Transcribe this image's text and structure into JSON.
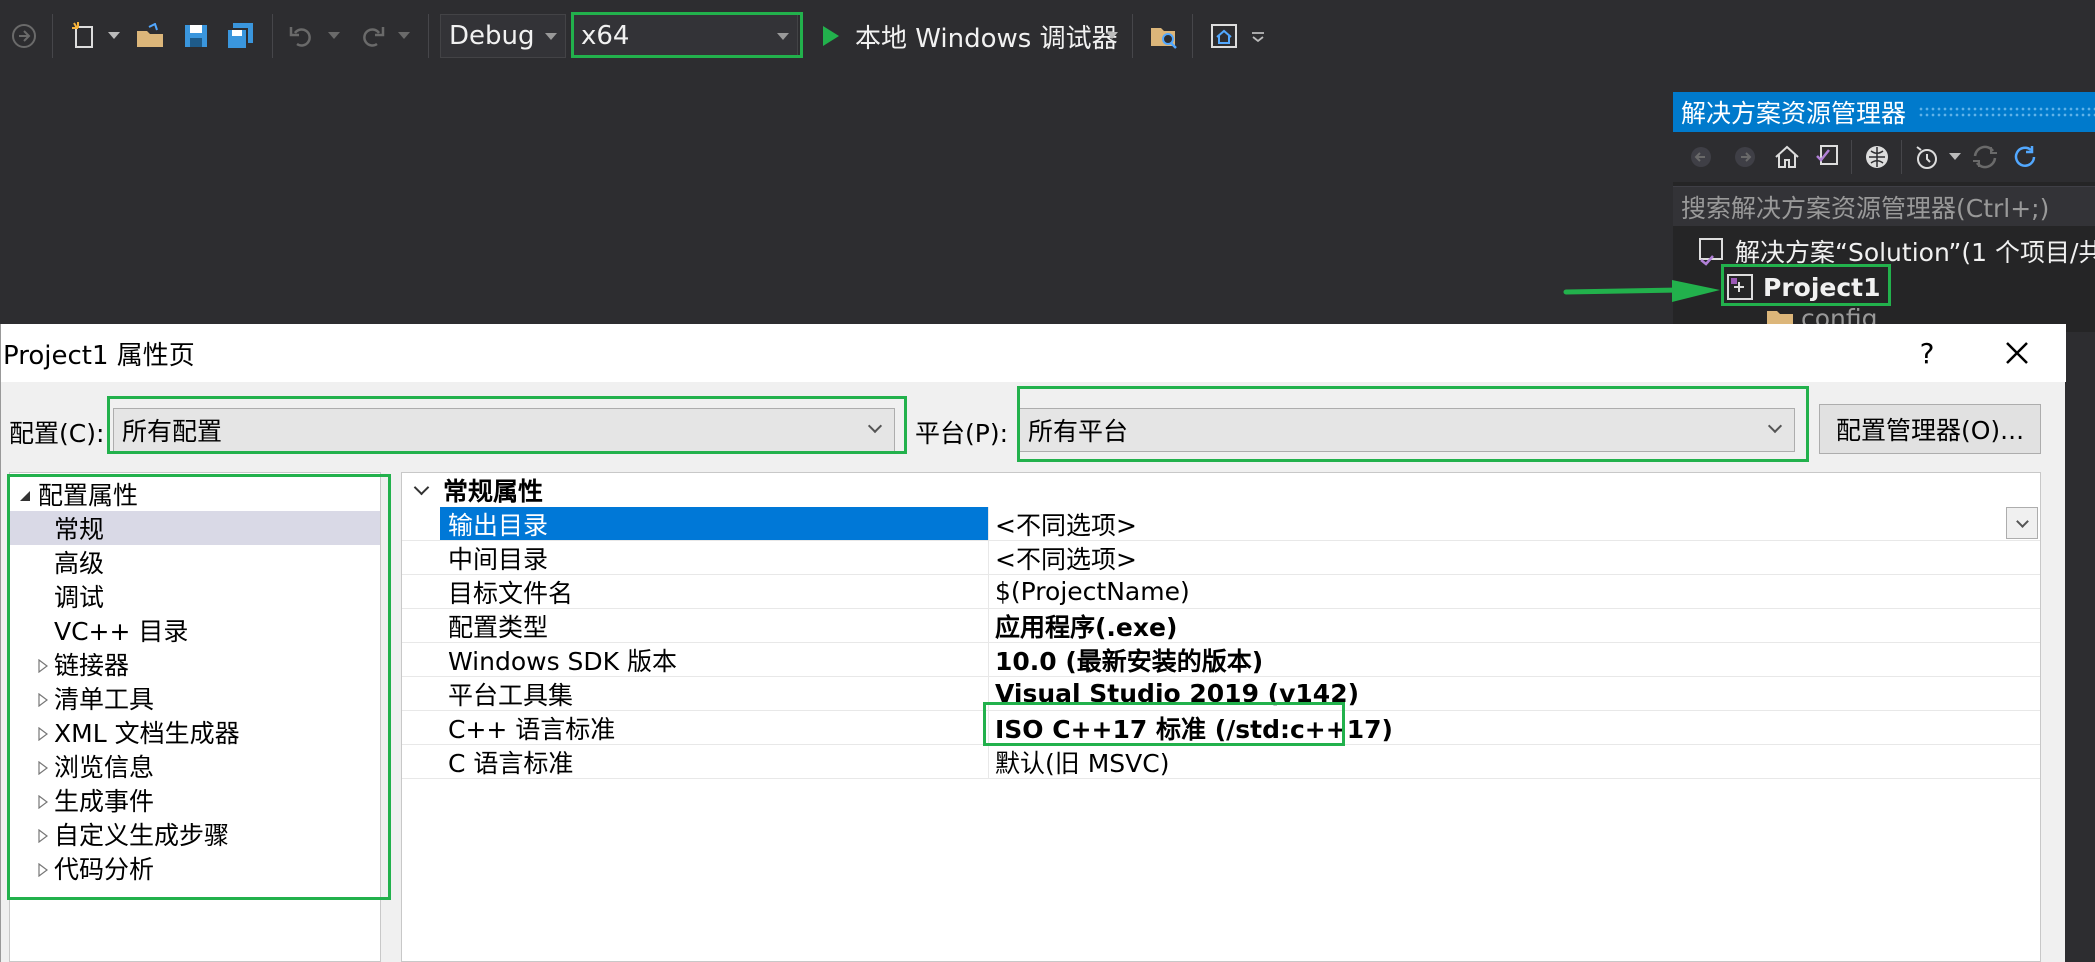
{
  "toolbar": {
    "configuration": "Debug",
    "platform": "x64",
    "run_label": "本地 Windows 调试器"
  },
  "solution_explorer": {
    "title": "解决方案资源管理器",
    "search_placeholder": "搜索解决方案资源管理器(Ctrl+;)",
    "solution_label": "解决方案“Solution”(1 个项目/共",
    "project_label": "Project1",
    "partial_folder": "config"
  },
  "dialog": {
    "title": "Project1 属性页",
    "help_label": "?",
    "close_label": "✕",
    "config_label": "配置(C):",
    "config_value": "所有配置",
    "platform_label": "平台(P):",
    "platform_value": "所有平台",
    "config_manager_label": "配置管理器(O)..."
  },
  "tree": {
    "root": "配置属性",
    "items": [
      {
        "label": "常规"
      },
      {
        "label": "高级"
      },
      {
        "label": "调试"
      },
      {
        "label": "VC++ 目录"
      },
      {
        "label": "链接器"
      },
      {
        "label": "清单工具"
      },
      {
        "label": "XML 文档生成器"
      },
      {
        "label": "浏览信息"
      },
      {
        "label": "生成事件"
      },
      {
        "label": "自定义生成步骤"
      },
      {
        "label": "代码分析"
      }
    ]
  },
  "grid": {
    "section": "常规属性",
    "rows": [
      {
        "name": "输出目录",
        "value": "<不同选项>"
      },
      {
        "name": "中间目录",
        "value": "<不同选项>"
      },
      {
        "name": "目标文件名",
        "value": "$(ProjectName)"
      },
      {
        "name": "配置类型",
        "value": "应用程序(.exe)"
      },
      {
        "name": "Windows SDK 版本",
        "value": "10.0 (最新安装的版本)"
      },
      {
        "name": "平台工具集",
        "value": "Visual Studio 2019 (v142)"
      },
      {
        "name": "C++ 语言标准",
        "value": "ISO C++17 标准 (/std:c++17)"
      },
      {
        "name": "C 语言标准",
        "value": "默认(旧 MSVC)"
      }
    ]
  },
  "colors": {
    "highlight": "#22b14c",
    "accent": "#007acc",
    "selection": "#0078d7"
  }
}
